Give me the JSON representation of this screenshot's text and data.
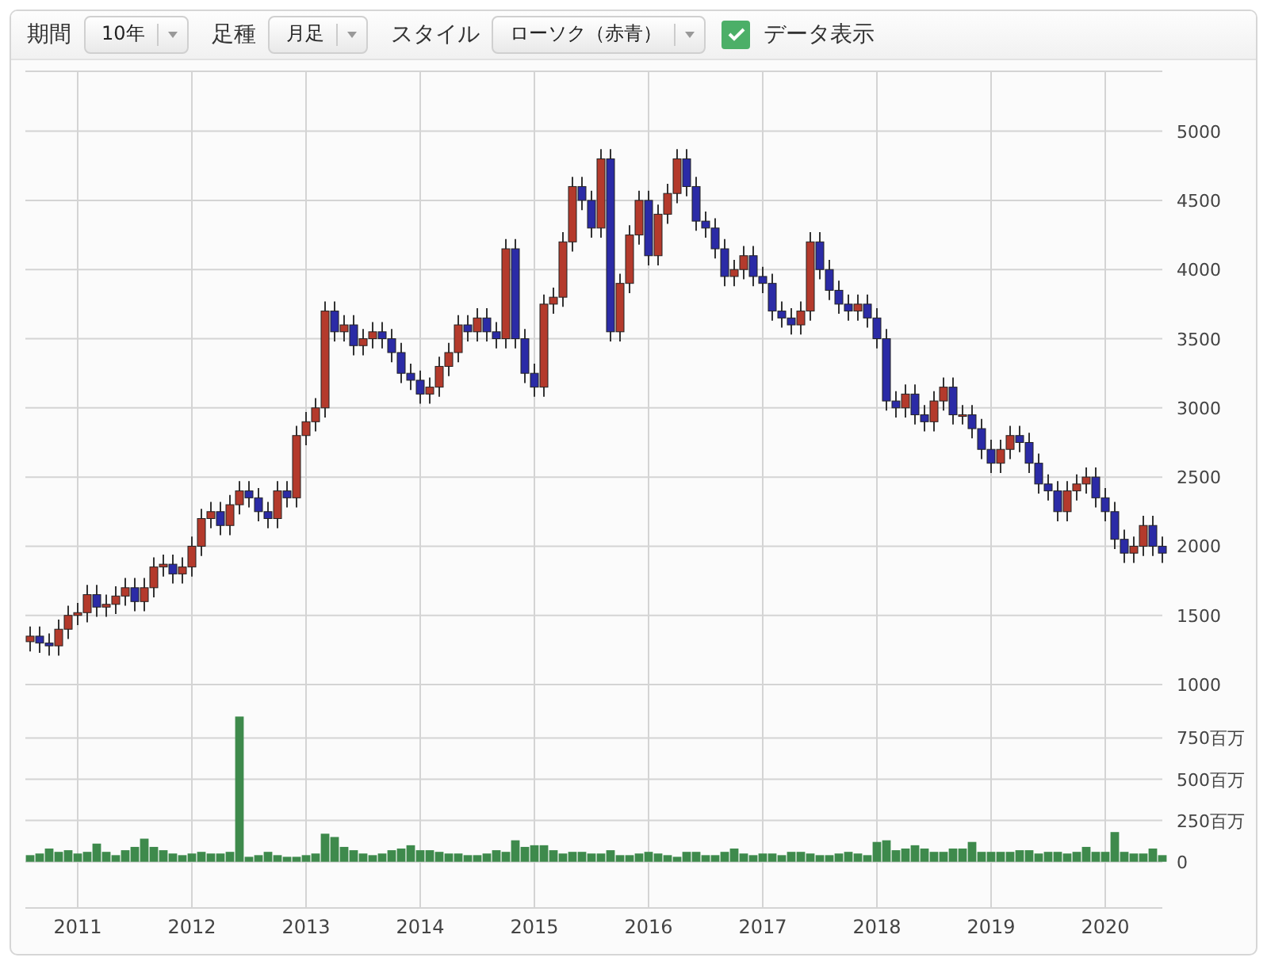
{
  "toolbar": {
    "items": [
      {
        "kind": "select",
        "label": "期間",
        "value": "10年"
      },
      {
        "kind": "select",
        "label": "足種",
        "value": "月足"
      },
      {
        "kind": "select",
        "label": "スタイル",
        "value": "ローソク（赤青）"
      },
      {
        "kind": "checkbox",
        "label": "データ表示",
        "checked": true
      }
    ]
  },
  "price_chart": {
    "chart_data": {
      "type": "candlestick",
      "grid": true,
      "ylim": [
        817,
        5433
      ],
      "categories": [
        null,
        null,
        null,
        null,
        null,
        null,
        null,
        null,
        null,
        null,
        null,
        null,
        null,
        null,
        null,
        null,
        null,
        null,
        null,
        null,
        null,
        null,
        null,
        null,
        null,
        null,
        null,
        null,
        null,
        null,
        null,
        null,
        null,
        null,
        null,
        null,
        null,
        null,
        null,
        null,
        null,
        null,
        null,
        null,
        null,
        null,
        null,
        null,
        null,
        null,
        null,
        null,
        null,
        null,
        null,
        null,
        null,
        null,
        null,
        null,
        null,
        null,
        null,
        null,
        null,
        null,
        null,
        null,
        null,
        null,
        null,
        null,
        null,
        null,
        null,
        null,
        null,
        null,
        null,
        null,
        null,
        null,
        null,
        null,
        null,
        null,
        null,
        null,
        null,
        null,
        null,
        null,
        null,
        null,
        null,
        null,
        null,
        null,
        null,
        null,
        null,
        null,
        null,
        null,
        null,
        null,
        null,
        null,
        null,
        null,
        null,
        null,
        null,
        null,
        null,
        null,
        null,
        null,
        null,
        null
      ],
      "yticks": [
        5000,
        4500,
        4000,
        3500,
        3000,
        2500,
        2000,
        1500,
        1000
      ],
      "ohlc": [
        [
          1310,
          1420,
          1240,
          1350
        ],
        [
          1350,
          1420,
          1230,
          1300
        ],
        [
          1300,
          1370,
          1210,
          1280
        ],
        [
          1280,
          1470,
          1210,
          1400
        ],
        [
          1400,
          1570,
          1330,
          1500
        ],
        [
          1500,
          1590,
          1430,
          1520
        ],
        [
          1520,
          1720,
          1450,
          1650
        ],
        [
          1650,
          1720,
          1490,
          1560
        ],
        [
          1560,
          1650,
          1490,
          1580
        ],
        [
          1580,
          1710,
          1510,
          1640
        ],
        [
          1640,
          1770,
          1570,
          1700
        ],
        [
          1700,
          1770,
          1530,
          1600
        ],
        [
          1600,
          1770,
          1530,
          1700
        ],
        [
          1700,
          1920,
          1630,
          1850
        ],
        [
          1850,
          1940,
          1780,
          1870
        ],
        [
          1870,
          1940,
          1730,
          1800
        ],
        [
          1800,
          1920,
          1730,
          1850
        ],
        [
          1850,
          2070,
          1780,
          2000
        ],
        [
          2000,
          2270,
          1930,
          2200
        ],
        [
          2200,
          2320,
          2130,
          2250
        ],
        [
          2250,
          2320,
          2080,
          2150
        ],
        [
          2150,
          2370,
          2080,
          2300
        ],
        [
          2300,
          2470,
          2230,
          2400
        ],
        [
          2400,
          2470,
          2280,
          2350
        ],
        [
          2350,
          2420,
          2180,
          2250
        ],
        [
          2250,
          2320,
          2130,
          2200
        ],
        [
          2200,
          2470,
          2130,
          2400
        ],
        [
          2400,
          2470,
          2280,
          2350
        ],
        [
          2350,
          2870,
          2280,
          2800
        ],
        [
          2800,
          2970,
          2730,
          2900
        ],
        [
          2900,
          3070,
          2830,
          3000
        ],
        [
          3000,
          3770,
          2930,
          3700
        ],
        [
          3700,
          3770,
          3480,
          3550
        ],
        [
          3550,
          3670,
          3480,
          3600
        ],
        [
          3600,
          3670,
          3380,
          3450
        ],
        [
          3450,
          3570,
          3380,
          3500
        ],
        [
          3500,
          3620,
          3430,
          3550
        ],
        [
          3550,
          3620,
          3430,
          3500
        ],
        [
          3500,
          3570,
          3330,
          3400
        ],
        [
          3400,
          3470,
          3180,
          3250
        ],
        [
          3250,
          3320,
          3130,
          3200
        ],
        [
          3200,
          3270,
          3030,
          3100
        ],
        [
          3100,
          3220,
          3030,
          3150
        ],
        [
          3150,
          3370,
          3080,
          3300
        ],
        [
          3300,
          3470,
          3230,
          3400
        ],
        [
          3400,
          3670,
          3330,
          3600
        ],
        [
          3600,
          3670,
          3480,
          3550
        ],
        [
          3550,
          3720,
          3480,
          3650
        ],
        [
          3650,
          3720,
          3480,
          3550
        ],
        [
          3550,
          3620,
          3430,
          3500
        ],
        [
          3500,
          4220,
          3430,
          4150
        ],
        [
          4150,
          4220,
          3430,
          3500
        ],
        [
          3500,
          3570,
          3180,
          3250
        ],
        [
          3250,
          3320,
          3080,
          3150
        ],
        [
          3150,
          3820,
          3080,
          3750
        ],
        [
          3750,
          3870,
          3680,
          3800
        ],
        [
          3800,
          4270,
          3730,
          4200
        ],
        [
          4200,
          4670,
          4130,
          4600
        ],
        [
          4600,
          4670,
          4430,
          4500
        ],
        [
          4500,
          4570,
          4230,
          4300
        ],
        [
          4300,
          4870,
          4230,
          4800
        ],
        [
          4800,
          4870,
          3480,
          3550
        ],
        [
          3550,
          3970,
          3480,
          3900
        ],
        [
          3900,
          4320,
          3830,
          4250
        ],
        [
          4250,
          4570,
          4180,
          4500
        ],
        [
          4500,
          4570,
          4030,
          4100
        ],
        [
          4100,
          4470,
          4030,
          4400
        ],
        [
          4400,
          4620,
          4330,
          4550
        ],
        [
          4550,
          4870,
          4480,
          4800
        ],
        [
          4800,
          4870,
          4530,
          4600
        ],
        [
          4600,
          4670,
          4280,
          4350
        ],
        [
          4350,
          4420,
          4230,
          4300
        ],
        [
          4300,
          4370,
          4080,
          4150
        ],
        [
          4150,
          4220,
          3880,
          3950
        ],
        [
          3950,
          4070,
          3880,
          4000
        ],
        [
          4000,
          4170,
          3930,
          4100
        ],
        [
          4100,
          4170,
          3880,
          3950
        ],
        [
          3950,
          4020,
          3830,
          3900
        ],
        [
          3900,
          3970,
          3630,
          3700
        ],
        [
          3700,
          3770,
          3580,
          3650
        ],
        [
          3650,
          3720,
          3530,
          3600
        ],
        [
          3600,
          3770,
          3530,
          3700
        ],
        [
          3700,
          4270,
          3630,
          4200
        ],
        [
          4200,
          4270,
          3930,
          4000
        ],
        [
          4000,
          4070,
          3780,
          3850
        ],
        [
          3850,
          3920,
          3680,
          3750
        ],
        [
          3750,
          3820,
          3630,
          3700
        ],
        [
          3700,
          3820,
          3630,
          3750
        ],
        [
          3750,
          3820,
          3580,
          3650
        ],
        [
          3650,
          3720,
          3430,
          3500
        ],
        [
          3500,
          3570,
          2980,
          3050
        ],
        [
          3050,
          3120,
          2930,
          3000
        ],
        [
          3000,
          3170,
          2930,
          3100
        ],
        [
          3100,
          3170,
          2880,
          2950
        ],
        [
          2950,
          3020,
          2830,
          2900
        ],
        [
          2900,
          3120,
          2830,
          3050
        ],
        [
          3050,
          3220,
          2980,
          3150
        ],
        [
          3150,
          3220,
          2880,
          2950
        ],
        [
          2950,
          3020,
          2880,
          2950
        ],
        [
          2950,
          3020,
          2780,
          2850
        ],
        [
          2850,
          2920,
          2630,
          2700
        ],
        [
          2700,
          2770,
          2530,
          2600
        ],
        [
          2600,
          2770,
          2530,
          2700
        ],
        [
          2700,
          2870,
          2630,
          2800
        ],
        [
          2800,
          2870,
          2680,
          2750
        ],
        [
          2750,
          2820,
          2530,
          2600
        ],
        [
          2600,
          2670,
          2380,
          2450
        ],
        [
          2450,
          2520,
          2330,
          2400
        ],
        [
          2400,
          2470,
          2180,
          2250
        ],
        [
          2250,
          2470,
          2180,
          2400
        ],
        [
          2400,
          2520,
          2330,
          2450
        ],
        [
          2450,
          2570,
          2380,
          2500
        ],
        [
          2500,
          2570,
          2280,
          2350
        ],
        [
          2350,
          2420,
          2180,
          2250
        ],
        [
          2250,
          2320,
          1980,
          2050
        ],
        [
          2050,
          2120,
          1880,
          1950
        ],
        [
          1950,
          2070,
          1880,
          2000
        ],
        [
          2000,
          2220,
          1930,
          2150
        ],
        [
          2150,
          2220,
          1930,
          2000
        ],
        [
          2000,
          2070,
          1880,
          1950
        ]
      ]
    }
  },
  "volume_chart": {
    "chart_data": {
      "type": "bar",
      "grid": true,
      "ylim": [
        -280,
        930
      ],
      "categories": [
        null,
        null,
        null,
        null,
        null,
        "2011",
        null,
        null,
        null,
        null,
        null,
        null,
        null,
        null,
        null,
        null,
        null,
        "2012",
        null,
        null,
        null,
        null,
        null,
        null,
        null,
        null,
        null,
        null,
        null,
        "2013",
        null,
        null,
        null,
        null,
        null,
        null,
        null,
        null,
        null,
        null,
        null,
        "2014",
        null,
        null,
        null,
        null,
        null,
        null,
        null,
        null,
        null,
        null,
        null,
        "2015",
        null,
        null,
        null,
        null,
        null,
        null,
        null,
        null,
        null,
        null,
        null,
        "2016",
        null,
        null,
        null,
        null,
        null,
        null,
        null,
        null,
        null,
        null,
        null,
        "2017",
        null,
        null,
        null,
        null,
        null,
        null,
        null,
        null,
        null,
        null,
        null,
        "2018",
        null,
        null,
        null,
        null,
        null,
        null,
        null,
        null,
        null,
        null,
        null,
        "2019",
        null,
        null,
        null,
        null,
        null,
        null,
        null,
        null,
        null,
        null,
        null,
        "2020",
        null,
        null,
        null,
        null,
        null,
        null
      ],
      "yticks": [
        {
          "value": 750,
          "label": "750百万"
        },
        {
          "value": 500,
          "label": "500百万"
        },
        {
          "value": 250,
          "label": "250百万"
        },
        {
          "value": 0,
          "label": "0"
        }
      ],
      "series": [
        {
          "color": "#3e8a4c",
          "values": [
            40,
            50,
            80,
            60,
            70,
            50,
            60,
            110,
            60,
            40,
            70,
            90,
            140,
            90,
            70,
            50,
            40,
            50,
            60,
            50,
            50,
            60,
            880,
            30,
            40,
            60,
            40,
            30,
            30,
            40,
            50,
            170,
            150,
            90,
            70,
            50,
            40,
            50,
            70,
            80,
            100,
            70,
            70,
            60,
            50,
            50,
            40,
            40,
            50,
            70,
            60,
            130,
            90,
            100,
            100,
            70,
            50,
            60,
            60,
            50,
            50,
            70,
            40,
            40,
            50,
            60,
            50,
            40,
            30,
            60,
            60,
            40,
            40,
            60,
            80,
            50,
            40,
            50,
            50,
            40,
            60,
            60,
            50,
            40,
            40,
            50,
            60,
            50,
            40,
            120,
            130,
            70,
            80,
            100,
            80,
            60,
            60,
            80,
            80,
            120,
            60,
            60,
            60,
            60,
            70,
            70,
            50,
            60,
            60,
            50,
            60,
            90,
            60,
            60,
            180,
            60,
            50,
            50,
            80,
            40
          ]
        }
      ]
    }
  }
}
